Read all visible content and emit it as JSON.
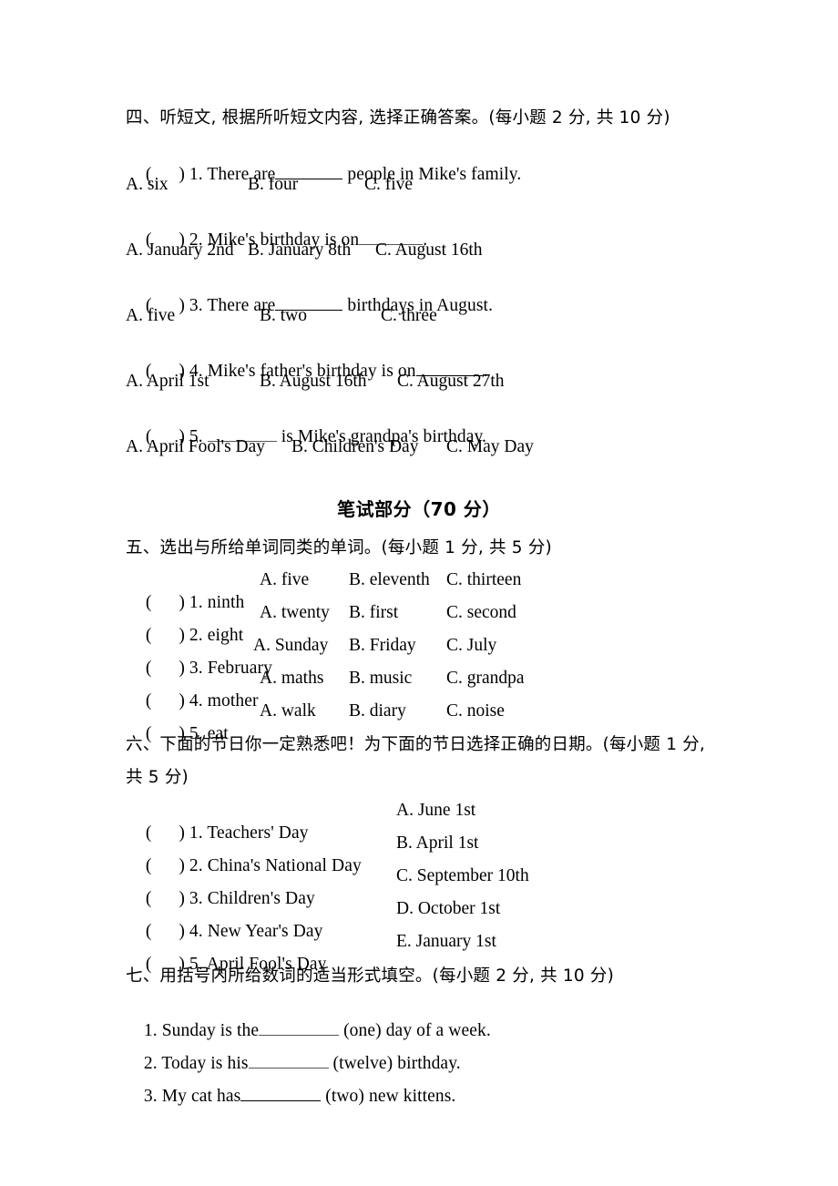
{
  "document": {
    "sections": [
      {
        "id": "section-four",
        "heading": "四、听短文, 根据所听短文内容, 选择正确答案。(每小题 2 分, 共 10 分)",
        "type": "listening-multiple-choice",
        "items": [
          {
            "bracket": "(      )",
            "number": "1.",
            "stem_before": "There are",
            "stem_after": "people in Mike's family.",
            "options": [
              "A. six",
              "B. four",
              "C. five"
            ]
          },
          {
            "bracket": "(      )",
            "number": "2.",
            "stem_before": "Mike's birthday is on",
            "stem_after": ".",
            "options": [
              "A. January 2nd",
              "B. January 8th",
              "C. August 16th"
            ]
          },
          {
            "bracket": "(      )",
            "number": "3.",
            "stem_before": "There are",
            "stem_after": "birthdays in August.",
            "options": [
              "A. five",
              "B. two",
              "C. three"
            ]
          },
          {
            "bracket": "(      )",
            "number": "4.",
            "stem_before": "Mike's father's birthday is on",
            "stem_after": ".",
            "options": [
              "A. April 1st",
              "B. August 16th",
              "C. August 27th"
            ]
          },
          {
            "bracket": "(      )",
            "number": "5.",
            "stem_before": "",
            "stem_after": "is Mike's grandpa's birthday.",
            "options": [
              "A. April Fool's Day",
              "B. Children's Day",
              "C. May Day"
            ]
          }
        ]
      },
      {
        "id": "written-part-title",
        "title": "笔试部分（70 分）"
      },
      {
        "id": "section-five",
        "heading": "五、选出与所给单词同类的单词。(每小题 1 分, 共 5 分)",
        "type": "odd-one-out",
        "items": [
          {
            "bracket": "(      )",
            "number": "1.",
            "word": "ninth",
            "options": [
              "A. five",
              "B. eleventh",
              "C. thirteen"
            ]
          },
          {
            "bracket": "(      )",
            "number": "2.",
            "word": "eight",
            "options": [
              "A. twenty",
              "B. first",
              "C. second"
            ]
          },
          {
            "bracket": "(      )",
            "number": "3.",
            "word": "February",
            "options": [
              "A. Sunday",
              "B. Friday",
              "C. July"
            ]
          },
          {
            "bracket": "(      )",
            "number": "4.",
            "word": "mother",
            "options": [
              "A. maths",
              "B. music",
              "C. grandpa"
            ]
          },
          {
            "bracket": "(      )",
            "number": "5.",
            "word": "eat",
            "options": [
              "A. walk",
              "B. diary",
              "C. noise"
            ]
          }
        ]
      },
      {
        "id": "section-six",
        "heading_line1": "六、下面的节日你一定熟悉吧！为下面的节日选择正确的日期。(每小题 1 分,",
        "heading_line2": "共 5 分)",
        "type": "matching",
        "items": [
          {
            "bracket": "(      )",
            "number": "1.",
            "left": "Teachers' Day",
            "right": "A. June 1st"
          },
          {
            "bracket": "(      )",
            "number": "2.",
            "left": "China's National Day",
            "right": "B. April 1st"
          },
          {
            "bracket": "(      )",
            "number": "3.",
            "left": "Children's Day",
            "right": "C. September 10th"
          },
          {
            "bracket": "(      )",
            "number": "4.",
            "left": "New Year's Day",
            "right": "D. October 1st"
          },
          {
            "bracket": "(      )",
            "number": "5.",
            "left": "April Fool's Day",
            "right": "E. January 1st"
          }
        ]
      },
      {
        "id": "section-seven",
        "heading": "七、用括号内所给数词的适当形式填空。(每小题 2 分, 共 10 分)",
        "type": "fill-in-the-blank",
        "items": [
          {
            "number": "1.",
            "before": "Sunday is the",
            "after": "(one) day of a week."
          },
          {
            "number": "2.",
            "before": "Today is his",
            "after": "(twelve) birthday."
          },
          {
            "number": "3.",
            "before": "My cat has",
            "after": "(two) new kittens."
          }
        ]
      }
    ]
  }
}
